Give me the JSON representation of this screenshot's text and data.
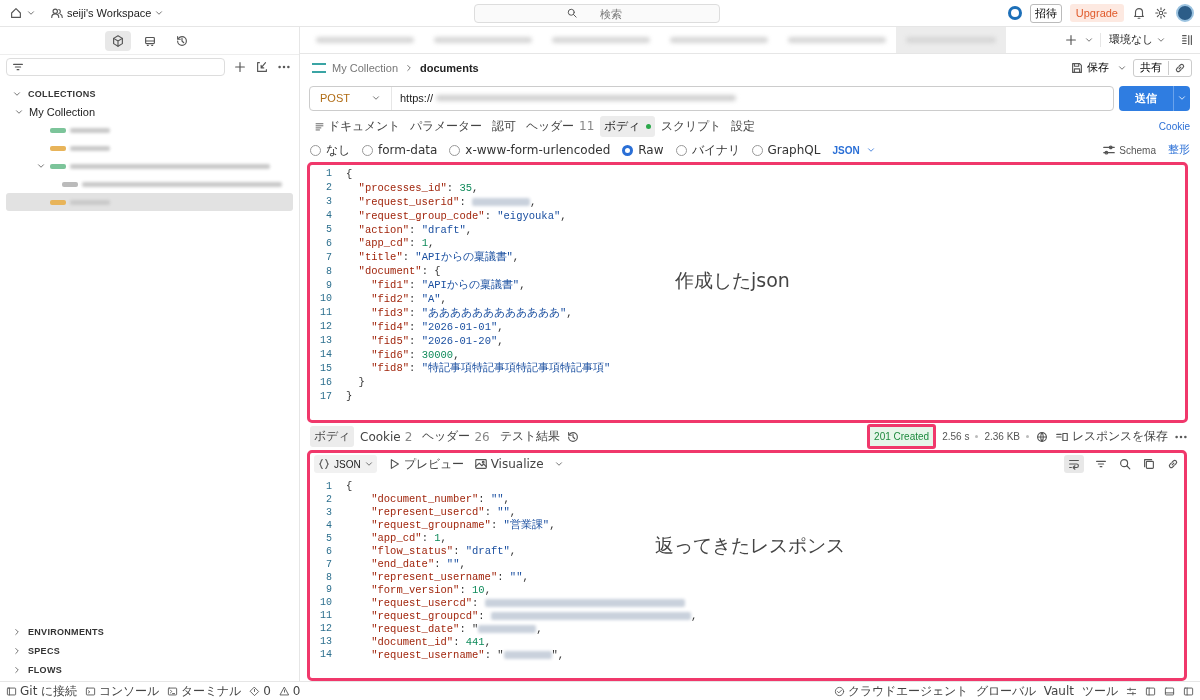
{
  "topbar": {
    "workspace": "seiji's Workspace",
    "search_placeholder": "検索",
    "invite": "招待",
    "upgrade": "Upgrade"
  },
  "sidebar": {
    "view_tabs": [
      {
        "kind": "collections",
        "selected": true
      },
      {
        "kind": "apis",
        "selected": false
      },
      {
        "kind": "history",
        "selected": false
      }
    ],
    "collections": {
      "label": "COLLECTIONS",
      "expanded": true,
      "items": [
        {
          "label": "My Collection",
          "expanded": true,
          "children": [
            {
              "kind": "redacted",
              "color": "#7cc49a",
              "selected": false
            },
            {
              "kind": "redacted",
              "color": "#e8b45a",
              "selected": false
            },
            {
              "kind": "redacted",
              "color": "#7cc49a",
              "selected": false,
              "expanded": true,
              "children": [
                {
                  "kind": "redacted",
                  "color": "#bbbbbb",
                  "selected": false
                }
              ]
            },
            {
              "kind": "redacted",
              "color": "#e8b45a",
              "selected": true
            }
          ]
        }
      ]
    },
    "sections": [
      {
        "label": "ENVIRONMENTS",
        "expanded": false
      },
      {
        "label": "SPECS",
        "expanded": false
      },
      {
        "label": "FLOWS",
        "expanded": false
      }
    ]
  },
  "open_tabs": [
    {
      "selected": false
    },
    {
      "selected": false
    },
    {
      "selected": false
    },
    {
      "selected": false
    },
    {
      "selected": false
    },
    {
      "selected": true
    }
  ],
  "environment": "環境なし",
  "request": {
    "breadcrumb": [
      "My Collection",
      "documents"
    ],
    "save": "保存",
    "share": "共有",
    "method": "POST",
    "url": "https://",
    "send": "送信",
    "tabs": [
      {
        "label": "ドキュメント",
        "kind": "docs",
        "selected": false
      },
      {
        "label": "パラメーター",
        "selected": false
      },
      {
        "label": "認可",
        "selected": false
      },
      {
        "label": "ヘッダー",
        "count": "11",
        "selected": false
      },
      {
        "label": "ボディ",
        "modified": true,
        "selected": true
      },
      {
        "label": "スクリプト",
        "selected": false
      },
      {
        "label": "設定",
        "selected": false
      }
    ],
    "cookie": "Cookie",
    "body_types": [
      {
        "label": "なし",
        "selected": false
      },
      {
        "label": "form-data",
        "selected": false
      },
      {
        "label": "x-www-form-urlencoded",
        "selected": false
      },
      {
        "label": "Raw",
        "selected": true
      },
      {
        "label": "バイナリ",
        "selected": false
      },
      {
        "label": "GraphQL",
        "selected": false
      }
    ],
    "format": "JSON",
    "schema": "Schema",
    "beautify": "整形",
    "editor": {
      "highlighted": true,
      "annotation": "作成したjson",
      "lines": [
        {
          "n": "1",
          "tokens": [
            {
              "kind": "punct",
              "text": "{"
            }
          ]
        },
        {
          "n": "2",
          "tokens": [
            {
              "kind": "key",
              "text": "  \"processes_id\""
            },
            {
              "kind": "punct",
              "text": ": "
            },
            {
              "kind": "num",
              "text": "35"
            },
            {
              "kind": "punct",
              "text": ","
            }
          ]
        },
        {
          "n": "3",
          "tokens": [
            {
              "kind": "key",
              "text": "  \"request_userid\""
            },
            {
              "kind": "punct",
              "text": ": "
            },
            {
              "kind": "redacted"
            },
            {
              "kind": "punct",
              "text": ","
            }
          ]
        },
        {
          "n": "4",
          "tokens": [
            {
              "kind": "key",
              "text": "  \"request_group_code\""
            },
            {
              "kind": "punct",
              "text": ": "
            },
            {
              "kind": "str",
              "text": "\"eigyouka\""
            },
            {
              "kind": "punct",
              "text": ","
            }
          ]
        },
        {
          "n": "5",
          "tokens": [
            {
              "kind": "key",
              "text": "  \"action\""
            },
            {
              "kind": "punct",
              "text": ": "
            },
            {
              "kind": "str",
              "text": "\"draft\""
            },
            {
              "kind": "punct",
              "text": ","
            }
          ]
        },
        {
          "n": "6",
          "tokens": [
            {
              "kind": "key",
              "text": "  \"app_cd\""
            },
            {
              "kind": "punct",
              "text": ": "
            },
            {
              "kind": "num",
              "text": "1"
            },
            {
              "kind": "punct",
              "text": ","
            }
          ]
        },
        {
          "n": "7",
          "tokens": [
            {
              "kind": "key",
              "text": "  \"title\""
            },
            {
              "kind": "punct",
              "text": ": "
            },
            {
              "kind": "str",
              "text": "\"APIからの稟議書\""
            },
            {
              "kind": "punct",
              "text": ","
            }
          ]
        },
        {
          "n": "8",
          "tokens": [
            {
              "kind": "key",
              "text": "  \"document\""
            },
            {
              "kind": "punct",
              "text": ": {"
            }
          ]
        },
        {
          "n": "9",
          "tokens": [
            {
              "kind": "key",
              "text": "    \"fid1\""
            },
            {
              "kind": "punct",
              "text": ": "
            },
            {
              "kind": "str",
              "text": "\"APIからの稟議書\""
            },
            {
              "kind": "punct",
              "text": ","
            }
          ]
        },
        {
          "n": "10",
          "tokens": [
            {
              "kind": "key",
              "text": "    \"fid2\""
            },
            {
              "kind": "punct",
              "text": ": "
            },
            {
              "kind": "str",
              "text": "\"A\""
            },
            {
              "kind": "punct",
              "text": ","
            }
          ]
        },
        {
          "n": "11",
          "tokens": [
            {
              "kind": "key",
              "text": "    \"fid3\""
            },
            {
              "kind": "punct",
              "text": ": "
            },
            {
              "kind": "str",
              "text": "\"ああああああああああああ\""
            },
            {
              "kind": "punct",
              "text": ","
            }
          ]
        },
        {
          "n": "12",
          "tokens": [
            {
              "kind": "key",
              "text": "    \"fid4\""
            },
            {
              "kind": "punct",
              "text": ": "
            },
            {
              "kind": "str",
              "text": "\"2026-01-01\""
            },
            {
              "kind": "punct",
              "text": ","
            }
          ]
        },
        {
          "n": "13",
          "tokens": [
            {
              "kind": "key",
              "text": "    \"fid5\""
            },
            {
              "kind": "punct",
              "text": ": "
            },
            {
              "kind": "str",
              "text": "\"2026-01-20\""
            },
            {
              "kind": "punct",
              "text": ","
            }
          ]
        },
        {
          "n": "14",
          "tokens": [
            {
              "kind": "key",
              "text": "    \"fid6\""
            },
            {
              "kind": "punct",
              "text": ": "
            },
            {
              "kind": "num",
              "text": "30000"
            },
            {
              "kind": "punct",
              "text": ","
            }
          ]
        },
        {
          "n": "15",
          "tokens": [
            {
              "kind": "key",
              "text": "    \"fid8\""
            },
            {
              "kind": "punct",
              "text": ": "
            },
            {
              "kind": "str",
              "text": "\"特記事項特記事項特記事項特記事項\""
            }
          ]
        },
        {
          "n": "16",
          "tokens": [
            {
              "kind": "punct",
              "text": "  }"
            }
          ]
        },
        {
          "n": "17",
          "tokens": [
            {
              "kind": "punct",
              "text": "}"
            }
          ]
        }
      ]
    }
  },
  "response": {
    "tabs": [
      {
        "label": "ボディ",
        "selected": true
      },
      {
        "label": "Cookie",
        "count": "2",
        "selected": false
      },
      {
        "label": "ヘッダー",
        "count": "26",
        "selected": false
      },
      {
        "label": "テスト結果",
        "selected": false
      }
    ],
    "status": "201 Created",
    "status_highlighted": true,
    "time": "2.56 s",
    "size": "2.36 KB",
    "save": "レスポンスを保存",
    "view": "JSON",
    "preview": "プレビュー",
    "visualize": "Visualize",
    "highlighted": true,
    "annotation": "返ってきたレスポンス",
    "lines": [
      {
        "n": "1",
        "tokens": [
          {
            "kind": "punct",
            "text": "{"
          }
        ]
      },
      {
        "n": "2",
        "tokens": [
          {
            "kind": "key",
            "text": "    \"document_number\""
          },
          {
            "kind": "punct",
            "text": ": "
          },
          {
            "kind": "str",
            "text": "\"\""
          },
          {
            "kind": "punct",
            "text": ","
          }
        ]
      },
      {
        "n": "3",
        "tokens": [
          {
            "kind": "key",
            "text": "    \"represent_usercd\""
          },
          {
            "kind": "punct",
            "text": ": "
          },
          {
            "kind": "str",
            "text": "\"\""
          },
          {
            "kind": "punct",
            "text": ","
          }
        ]
      },
      {
        "n": "4",
        "tokens": [
          {
            "kind": "key",
            "text": "    \"request_groupname\""
          },
          {
            "kind": "punct",
            "text": ": "
          },
          {
            "kind": "str",
            "text": "\"営業課\""
          },
          {
            "kind": "punct",
            "text": ","
          }
        ]
      },
      {
        "n": "5",
        "tokens": [
          {
            "kind": "key",
            "text": "    \"app_cd\""
          },
          {
            "kind": "punct",
            "text": ": "
          },
          {
            "kind": "num",
            "text": "1"
          },
          {
            "kind": "punct",
            "text": ","
          }
        ]
      },
      {
        "n": "6",
        "tokens": [
          {
            "kind": "key",
            "text": "    \"flow_status\""
          },
          {
            "kind": "punct",
            "text": ": "
          },
          {
            "kind": "str",
            "text": "\"draft\""
          },
          {
            "kind": "punct",
            "text": ","
          }
        ]
      },
      {
        "n": "7",
        "tokens": [
          {
            "kind": "key",
            "text": "    \"end_date\""
          },
          {
            "kind": "punct",
            "text": ": "
          },
          {
            "kind": "str",
            "text": "\"\""
          },
          {
            "kind": "punct",
            "text": ","
          }
        ]
      },
      {
        "n": "8",
        "tokens": [
          {
            "kind": "key",
            "text": "    \"represent_username\""
          },
          {
            "kind": "punct",
            "text": ": "
          },
          {
            "kind": "str",
            "text": "\"\""
          },
          {
            "kind": "punct",
            "text": ","
          }
        ]
      },
      {
        "n": "9",
        "tokens": [
          {
            "kind": "key",
            "text": "    \"form_version\""
          },
          {
            "kind": "punct",
            "text": ": "
          },
          {
            "kind": "num",
            "text": "10"
          },
          {
            "kind": "punct",
            "text": ","
          }
        ]
      },
      {
        "n": "10",
        "tokens": [
          {
            "kind": "key",
            "text": "    \"request_usercd\""
          },
          {
            "kind": "punct",
            "text": ": "
          },
          {
            "kind": "redacted_long"
          }
        ]
      },
      {
        "n": "11",
        "tokens": [
          {
            "kind": "key",
            "text": "    \"request_groupcd\""
          },
          {
            "kind": "punct",
            "text": ": "
          },
          {
            "kind": "redacted_long"
          },
          {
            "kind": "punct",
            "text": ","
          }
        ]
      },
      {
        "n": "12",
        "tokens": [
          {
            "kind": "key",
            "text": "    \"request_date\""
          },
          {
            "kind": "punct",
            "text": ": \""
          },
          {
            "kind": "redacted"
          },
          {
            "kind": "punct",
            "text": ","
          }
        ]
      },
      {
        "n": "13",
        "tokens": [
          {
            "kind": "key",
            "text": "    \"document_id\""
          },
          {
            "kind": "punct",
            "text": ": "
          },
          {
            "kind": "num",
            "text": "441"
          },
          {
            "kind": "punct",
            "text": ","
          }
        ]
      },
      {
        "n": "14",
        "tokens": [
          {
            "kind": "key",
            "text": "    \"request_username\""
          },
          {
            "kind": "punct",
            "text": ": \""
          },
          {
            "kind": "redacted_short"
          },
          {
            "kind": "punct",
            "text": "\","
          }
        ]
      }
    ]
  },
  "status_bar": {
    "left": [
      {
        "kind": "git",
        "label": "Git に接続"
      },
      {
        "kind": "console",
        "label": "コンソール"
      },
      {
        "kind": "terminal",
        "label": "ターミナル"
      },
      {
        "kind": "errors",
        "label": "0"
      },
      {
        "kind": "warnings",
        "label": "0"
      }
    ],
    "right": [
      {
        "kind": "agent",
        "label": "クラウドエージェント"
      },
      {
        "kind": "text",
        "label": "グローバル"
      },
      {
        "kind": "text",
        "label": "Vault"
      },
      {
        "kind": "text",
        "label": "ツール"
      }
    ]
  }
}
